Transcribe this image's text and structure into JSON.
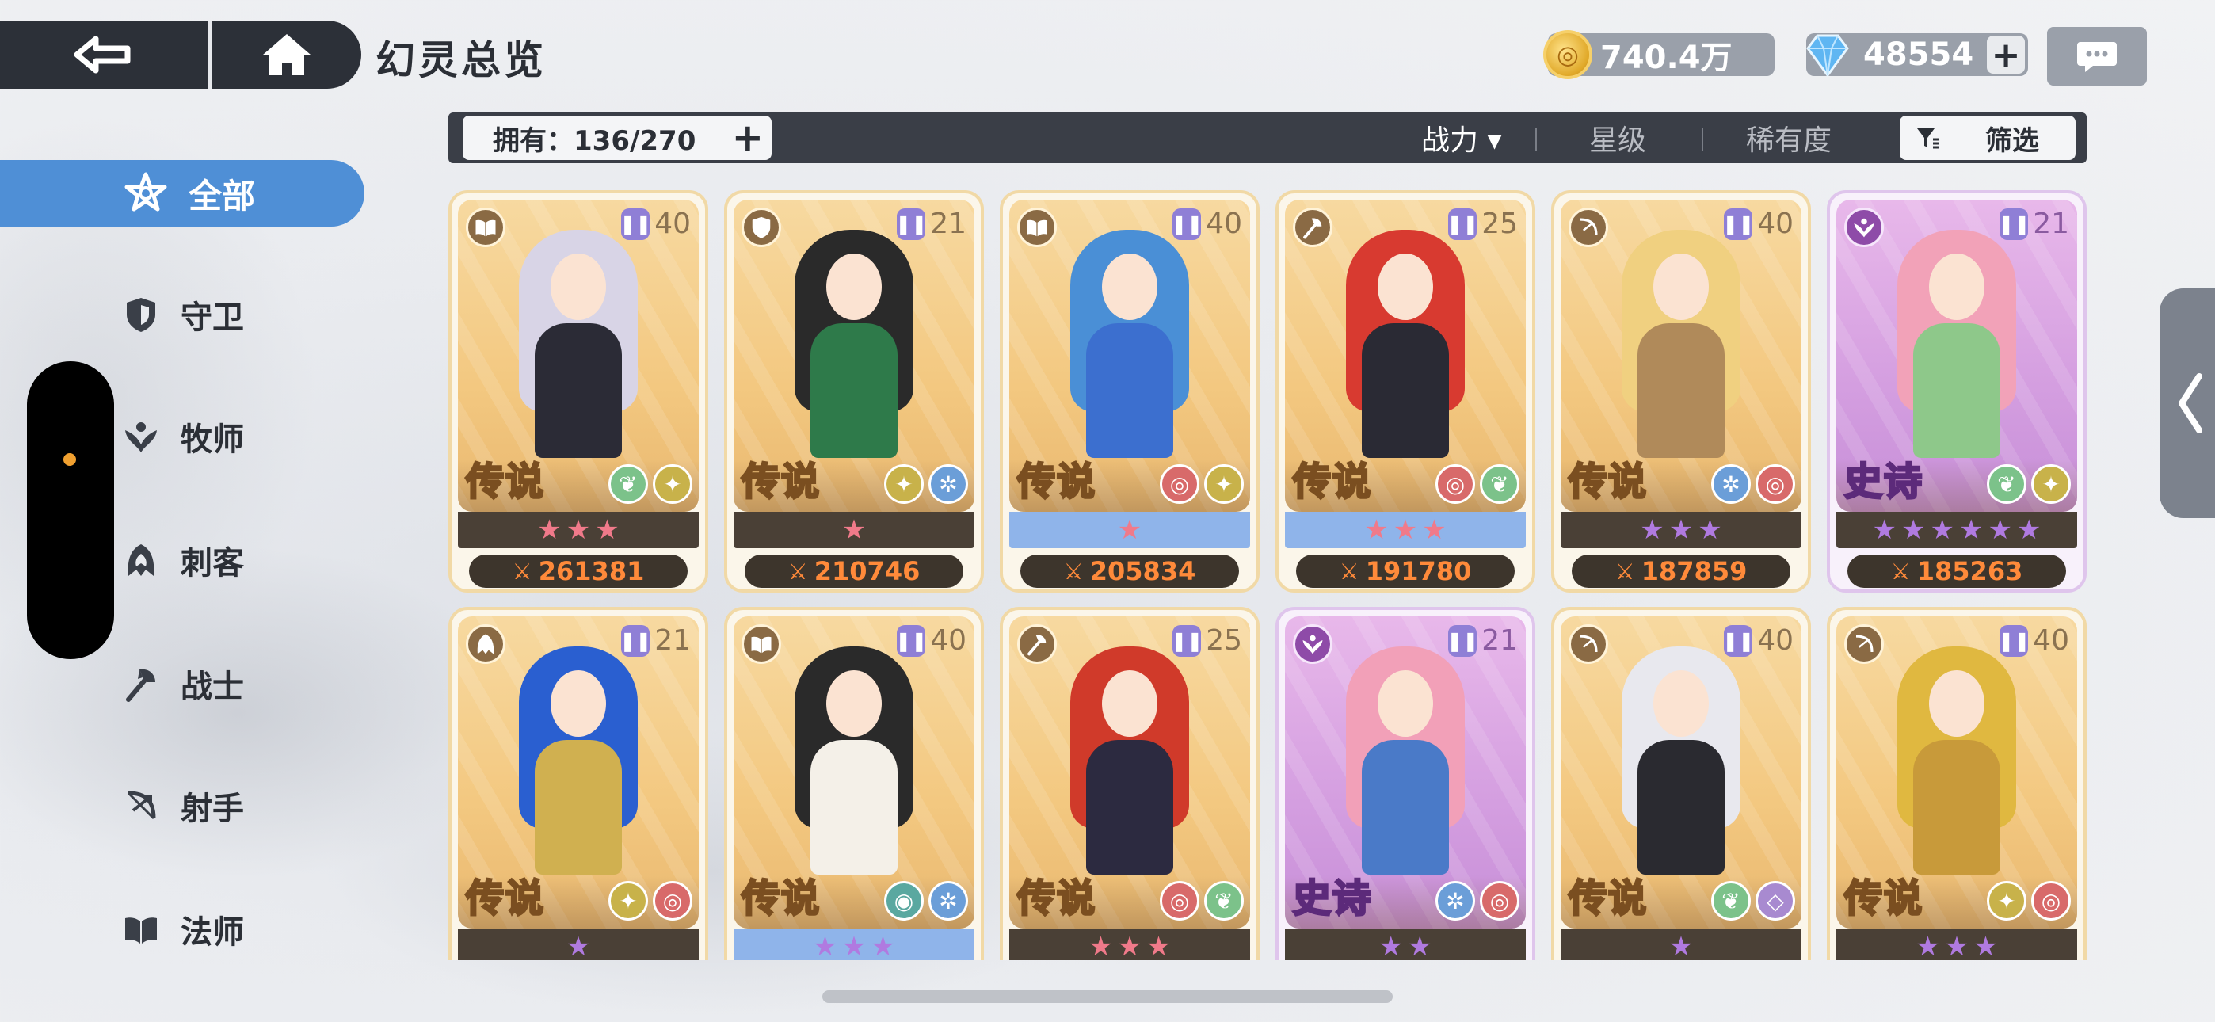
{
  "header": {
    "title": "幻灵总览",
    "gold": "740.4万",
    "gems": "48554"
  },
  "filter": {
    "owned_label": "拥有：136/270",
    "sort_power": "战力 ▾",
    "sort_star": "星级",
    "sort_rarity": "稀有度",
    "screen_label": "筛选"
  },
  "sidebar": {
    "items": [
      {
        "label": "全部",
        "icon": "all-star-icon",
        "active": true
      },
      {
        "label": "守卫",
        "icon": "shield-icon"
      },
      {
        "label": "牧师",
        "icon": "priest-icon"
      },
      {
        "label": "刺客",
        "icon": "assassin-icon"
      },
      {
        "label": "战士",
        "icon": "axe-icon"
      },
      {
        "label": "射手",
        "icon": "bow-icon"
      },
      {
        "label": "法师",
        "icon": "book-icon"
      }
    ]
  },
  "colors": {
    "accent": "#4f8fd6",
    "legend_card": "#f3c880",
    "epic_card": "#d49ee0",
    "power_text": "#ff8a3a",
    "star_pink": "#f07a8a",
    "star_purple": "#b07ae0"
  },
  "cards": [
    {
      "rarity": "传说",
      "level": "40",
      "class_icon": "book-icon",
      "stars": 3,
      "star_color": "pink",
      "power": "261381",
      "tier": "legend",
      "elements": [
        "leaf",
        "wing"
      ],
      "bar": "dark",
      "hair": "#d8d4e6",
      "body": "#2b2b36"
    },
    {
      "rarity": "传说",
      "level": "21",
      "class_icon": "shield-icon",
      "stars": 1,
      "star_color": "pink",
      "power": "210746",
      "tier": "legend",
      "elements": [
        "wing",
        "frost"
      ],
      "bar": "dark",
      "hair": "#2a2a2a",
      "body": "#2e7a4a"
    },
    {
      "rarity": "传说",
      "level": "40",
      "class_icon": "book-icon",
      "stars": 1,
      "star_color": "pink",
      "power": "205834",
      "tier": "legend",
      "elements": [
        "swirl",
        "wing"
      ],
      "bar": "blue",
      "hair": "#4a8fd6",
      "body": "#3c6fcf"
    },
    {
      "rarity": "传说",
      "level": "25",
      "class_icon": "axe-icon",
      "stars": 3,
      "star_color": "pink",
      "power": "191780",
      "tier": "legend",
      "elements": [
        "swirl",
        "leaf"
      ],
      "bar": "blue",
      "hair": "#d83a30",
      "body": "#2a2a34"
    },
    {
      "rarity": "传说",
      "level": "40",
      "class_icon": "bow-icon",
      "stars": 3,
      "star_color": "purple",
      "power": "187859",
      "tier": "legend",
      "elements": [
        "frost",
        "swirl"
      ],
      "bar": "dark",
      "hair": "#f0d080",
      "body": "#b08a5a"
    },
    {
      "rarity": "史诗",
      "level": "21",
      "class_icon": "priest-icon",
      "stars": 6,
      "star_color": "purple",
      "power": "185263",
      "tier": "epic",
      "elements": [
        "leaf",
        "wing"
      ],
      "bar": "dark",
      "hair": "#f2a2b8",
      "body": "#8ec88a"
    },
    {
      "rarity": "传说",
      "level": "21",
      "class_icon": "assassin-icon",
      "stars": 1,
      "star_color": "purple",
      "power": "",
      "tier": "legend",
      "elements": [
        "wing",
        "swirl"
      ],
      "bar": "dark",
      "hair": "#2a5fd0",
      "body": "#d0b050"
    },
    {
      "rarity": "传说",
      "level": "40",
      "class_icon": "book-icon",
      "stars": 3,
      "star_color": "purple",
      "power": "",
      "tier": "legend",
      "elements": [
        "eye",
        "frost"
      ],
      "bar": "blue",
      "hair": "#2a2a2a",
      "body": "#f4f0e8"
    },
    {
      "rarity": "传说",
      "level": "25",
      "class_icon": "axe-icon",
      "stars": 3,
      "star_color": "pink",
      "power": "",
      "tier": "legend",
      "elements": [
        "swirl",
        "leaf"
      ],
      "bar": "dark",
      "hair": "#d03a2a",
      "body": "#2c2a40"
    },
    {
      "rarity": "史诗",
      "level": "21",
      "class_icon": "priest-icon",
      "stars": 2,
      "star_color": "purple",
      "power": "",
      "tier": "epic",
      "elements": [
        "frost",
        "swirl"
      ],
      "bar": "dark",
      "hair": "#f2a0b8",
      "body": "#4a7ac8"
    },
    {
      "rarity": "传说",
      "level": "40",
      "class_icon": "bow-icon",
      "stars": 1,
      "star_color": "purple",
      "power": "",
      "tier": "legend",
      "elements": [
        "leaf",
        "ring"
      ],
      "bar": "dark",
      "hair": "#e8e8ee",
      "body": "#2a2a30"
    },
    {
      "rarity": "传说",
      "level": "40",
      "class_icon": "bow-icon",
      "stars": 3,
      "star_color": "purple",
      "power": "",
      "tier": "legend",
      "elements": [
        "wing",
        "swirl"
      ],
      "bar": "dark",
      "hair": "#e0b840",
      "body": "#c89a3a"
    }
  ]
}
